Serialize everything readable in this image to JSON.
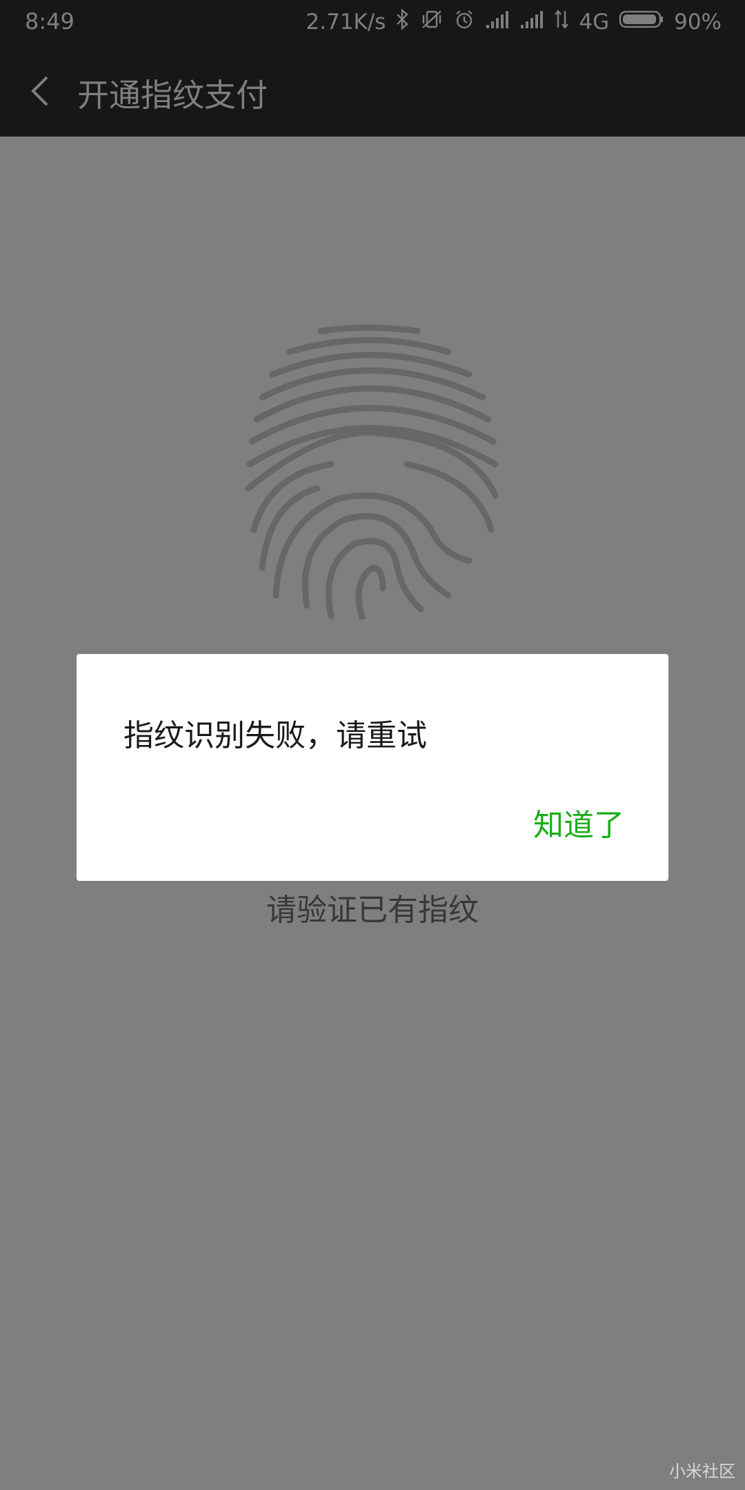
{
  "status_bar": {
    "time": "8:49",
    "speed": "2.71K/s",
    "network": "4G",
    "battery": "90%",
    "icons": [
      "bluetooth-icon",
      "vibrate-icon",
      "alarm-icon",
      "signal-icon",
      "signal-icon",
      "data-arrows-icon",
      "battery-icon"
    ]
  },
  "header": {
    "title": "开通指纹支付"
  },
  "main": {
    "hint": "请验证已有指纹",
    "icon": "fingerprint-icon"
  },
  "dialog": {
    "message": "指纹识别失败，请重试",
    "ok_label": "知道了"
  },
  "watermark": "小米社区",
  "colors": {
    "accent": "#1aad19",
    "header_bg": "#2e2e2e",
    "overlay": "rgba(0,0,0,0.5)"
  }
}
